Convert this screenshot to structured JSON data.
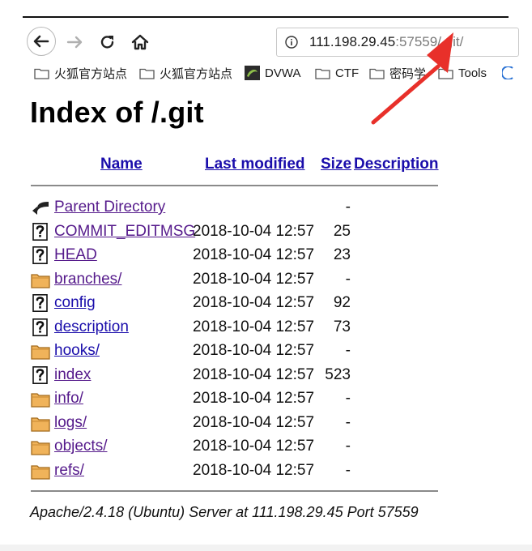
{
  "browser": {
    "url": {
      "host": "111.198.29.45",
      "port_sep": ":",
      "port": "57559",
      "path": "/.git/"
    },
    "bookmarks": [
      {
        "label": "火狐官方站点",
        "icon": "folder-icon"
      },
      {
        "label": "火狐官方站点",
        "icon": "folder-icon"
      },
      {
        "label": "DVWA",
        "icon": "dvwa-icon"
      },
      {
        "label": "CTF",
        "icon": "folder-icon"
      },
      {
        "label": "密码学",
        "icon": "folder-icon"
      },
      {
        "label": "Tools",
        "icon": "folder-icon"
      }
    ]
  },
  "page": {
    "title": "Index of /.git",
    "columns": {
      "name": "Name",
      "last_modified": "Last modified",
      "size": "Size",
      "description": "Description"
    },
    "entries": [
      {
        "name": "Parent Directory",
        "date": "",
        "size": "-",
        "icon": "back-arrow-icon",
        "visited": true
      },
      {
        "name": "COMMIT_EDITMSG",
        "date": "2018-10-04 12:57",
        "size": "25",
        "icon": "unknown-file-icon",
        "visited": true
      },
      {
        "name": "HEAD",
        "date": "2018-10-04 12:57",
        "size": "23",
        "icon": "unknown-file-icon",
        "visited": true
      },
      {
        "name": "branches/",
        "date": "2018-10-04 12:57",
        "size": "-",
        "icon": "folder-icon",
        "visited": true
      },
      {
        "name": "config",
        "date": "2018-10-04 12:57",
        "size": "92",
        "icon": "unknown-file-icon",
        "visited": false
      },
      {
        "name": "description",
        "date": "2018-10-04 12:57",
        "size": "73",
        "icon": "unknown-file-icon",
        "visited": false
      },
      {
        "name": "hooks/",
        "date": "2018-10-04 12:57",
        "size": "-",
        "icon": "folder-icon",
        "visited": false
      },
      {
        "name": "index",
        "date": "2018-10-04 12:57",
        "size": "523",
        "icon": "unknown-file-icon",
        "visited": true
      },
      {
        "name": "info/",
        "date": "2018-10-04 12:57",
        "size": "-",
        "icon": "folder-icon",
        "visited": true
      },
      {
        "name": "logs/",
        "date": "2018-10-04 12:57",
        "size": "-",
        "icon": "folder-icon",
        "visited": true
      },
      {
        "name": "objects/",
        "date": "2018-10-04 12:57",
        "size": "-",
        "icon": "folder-icon",
        "visited": true
      },
      {
        "name": "refs/",
        "date": "2018-10-04 12:57",
        "size": "-",
        "icon": "folder-icon",
        "visited": true
      }
    ],
    "footer": "Apache/2.4.18 (Ubuntu) Server at 111.198.29.45 Port 57559"
  },
  "annotation": {
    "icon": "red-arrow-icon",
    "color": "#e8302a"
  },
  "colors": {
    "link": "#1a0dab",
    "visited": "#551a8b",
    "folder": "#e8a23a"
  }
}
